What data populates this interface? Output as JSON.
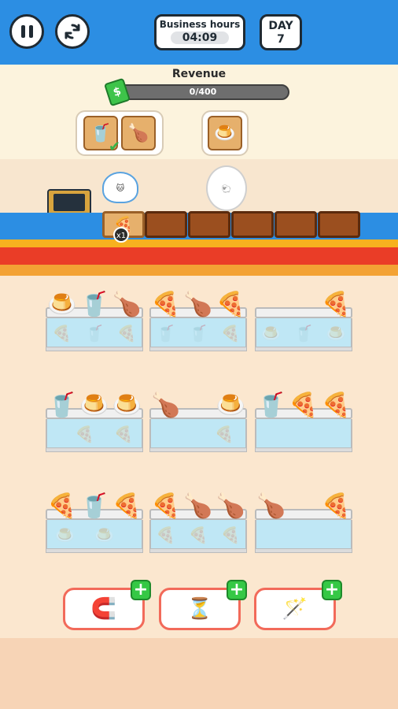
{
  "header": {
    "business_hours_label": "Business hours",
    "business_hours_value": "04:09",
    "day_label": "DAY",
    "day_value": "7"
  },
  "revenue": {
    "label": "Revenue",
    "progress_text": "0/400",
    "progress_fraction": 0
  },
  "icons": {
    "pause": "pause-icon",
    "restart": "restart-icon",
    "cash": "cash-icon"
  },
  "orders": [
    {
      "customer": "cat",
      "items": [
        "coffee-cup",
        "chicken-nugget"
      ],
      "completed": [
        "coffee-cup"
      ]
    },
    {
      "customer": "sheep",
      "items": [
        "pudding"
      ]
    }
  ],
  "conveyor": {
    "active_item": "pizza-slice",
    "active_count": "x1",
    "slots_total": 6
  },
  "shelves": [
    {
      "items": [
        "pudding",
        "coffee-cup",
        "chicken-nugget"
      ],
      "hidden": [
        "pizza",
        "coffee-cup",
        "pizza"
      ]
    },
    {
      "items": [
        "pizza",
        "chicken-nugget",
        "pizza"
      ],
      "hidden": [
        "coffee-cup",
        "coffee-cup",
        "pizza"
      ]
    },
    {
      "items": [
        "",
        "",
        "pizza-slice"
      ],
      "hidden": [
        "pudding",
        "coffee-cup",
        "pudding"
      ]
    },
    {
      "items": [
        "coffee-cup",
        "pudding",
        "pudding"
      ],
      "hidden": [
        "",
        "pizza",
        "pizza"
      ]
    },
    {
      "items": [
        "chicken-nugget",
        "",
        "pudding"
      ],
      "hidden": [
        "",
        "",
        "pizza-slice"
      ]
    },
    {
      "items": [
        "coffee-cup",
        "pizza",
        "pizza-slice"
      ],
      "hidden": [
        "",
        "",
        ""
      ]
    },
    {
      "items": [
        "pizza-slice",
        "coffee-cup",
        "pizza-slice"
      ],
      "hidden": [
        "pudding",
        "pudding",
        ""
      ]
    },
    {
      "items": [
        "pizza-slice",
        "chicken-nugget",
        "chicken-nugget"
      ],
      "hidden": [
        "pizza-slice",
        "pizza",
        "pizza"
      ]
    },
    {
      "items": [
        "chicken-nugget",
        "",
        "pizza"
      ],
      "hidden": [
        "",
        "",
        ""
      ]
    }
  ],
  "powerups": [
    {
      "name": "magnet",
      "icon": "magnet-icon"
    },
    {
      "name": "hourglass",
      "icon": "hourglass-icon"
    },
    {
      "name": "magic-wand",
      "icon": "magic-wand-icon"
    }
  ]
}
